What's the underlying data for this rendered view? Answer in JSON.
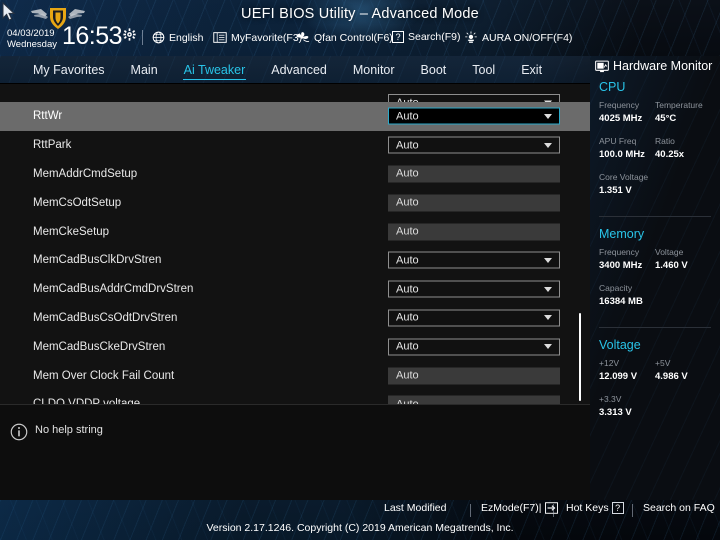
{
  "header": {
    "title": "UEFI BIOS Utility – Advanced Mode",
    "date": "04/03/2019",
    "weekday": "Wednesday",
    "time": "16:53",
    "gear_icon": "gear-icon",
    "items": [
      {
        "label": "English",
        "icon": "globe-icon"
      },
      {
        "label": "MyFavorite(F3)",
        "icon": "favorites-icon"
      },
      {
        "label": "Qfan Control(F6)",
        "icon": "fan-icon"
      },
      {
        "label": "Search(F9)",
        "icon": "question-box-icon"
      },
      {
        "label": "AURA ON/OFF(F4)",
        "icon": "aura-light-icon"
      }
    ]
  },
  "nav": {
    "tabs": [
      {
        "label": "My Favorites",
        "active": false
      },
      {
        "label": "Main",
        "active": false
      },
      {
        "label": "Ai Tweaker",
        "active": true
      },
      {
        "label": "Advanced",
        "active": false
      },
      {
        "label": "Monitor",
        "active": false
      },
      {
        "label": "Boot",
        "active": false
      },
      {
        "label": "Tool",
        "active": false
      },
      {
        "label": "Exit",
        "active": false
      }
    ],
    "active_color": "#29c4e8"
  },
  "settings": {
    "partial_row_top": {
      "label": "",
      "value": "Auto",
      "type": "dropdown"
    },
    "rows": [
      {
        "label": "RttWr",
        "value": "Auto",
        "type": "dropdown",
        "selected": true
      },
      {
        "label": "RttPark",
        "value": "Auto",
        "type": "dropdown",
        "selected": false
      },
      {
        "label": "MemAddrCmdSetup",
        "value": "Auto",
        "type": "text",
        "selected": false
      },
      {
        "label": "MemCsOdtSetup",
        "value": "Auto",
        "type": "text",
        "selected": false
      },
      {
        "label": "MemCkeSetup",
        "value": "Auto",
        "type": "text",
        "selected": false
      },
      {
        "label": "MemCadBusClkDrvStren",
        "value": "Auto",
        "type": "dropdown",
        "selected": false
      },
      {
        "label": "MemCadBusAddrCmdDrvStren",
        "value": "Auto",
        "type": "dropdown",
        "selected": false
      },
      {
        "label": "MemCadBusCsOdtDrvStren",
        "value": "Auto",
        "type": "dropdown",
        "selected": false
      },
      {
        "label": "MemCadBusCkeDrvStren",
        "value": "Auto",
        "type": "dropdown",
        "selected": false
      },
      {
        "label": "Mem Over Clock Fail Count",
        "value": "Auto",
        "type": "text",
        "selected": false
      },
      {
        "label": "CLDO VDDP voltage",
        "value": "Auto",
        "type": "text",
        "selected": false
      }
    ]
  },
  "help": {
    "text": "No help string",
    "icon": "info-icon"
  },
  "hardware_monitor": {
    "title": "Hardware Monitor",
    "icon": "monitor-icon",
    "sections": [
      {
        "name": "CPU",
        "pairs": [
          [
            {
              "key": "Frequency",
              "value": "4025 MHz"
            },
            {
              "key": "Temperature",
              "value": "45°C"
            }
          ],
          [
            {
              "key": "APU Freq",
              "value": "100.0 MHz"
            },
            {
              "key": "Ratio",
              "value": "40.25x"
            }
          ],
          [
            {
              "key": "Core Voltage",
              "value": "1.351 V"
            }
          ]
        ]
      },
      {
        "name": "Memory",
        "pairs": [
          [
            {
              "key": "Frequency",
              "value": "3400 MHz"
            },
            {
              "key": "Voltage",
              "value": "1.460 V"
            }
          ],
          [
            {
              "key": "Capacity",
              "value": "16384 MB"
            }
          ]
        ]
      },
      {
        "name": "Voltage",
        "pairs": [
          [
            {
              "key": "+12V",
              "value": "12.099 V"
            },
            {
              "key": "+5V",
              "value": "4.986 V"
            }
          ],
          [
            {
              "key": "+3.3V",
              "value": "3.313 V"
            }
          ]
        ]
      }
    ]
  },
  "footer": {
    "links": [
      {
        "label": "Last Modified",
        "key": ""
      },
      {
        "label": "EzMode(F7)|",
        "key": "arrow"
      },
      {
        "label": "Hot Keys",
        "key": "?"
      },
      {
        "label": "Search on FAQ",
        "key": ""
      }
    ],
    "version": "Version 2.17.1246. Copyright (C) 2019 American Megatrends, Inc."
  }
}
